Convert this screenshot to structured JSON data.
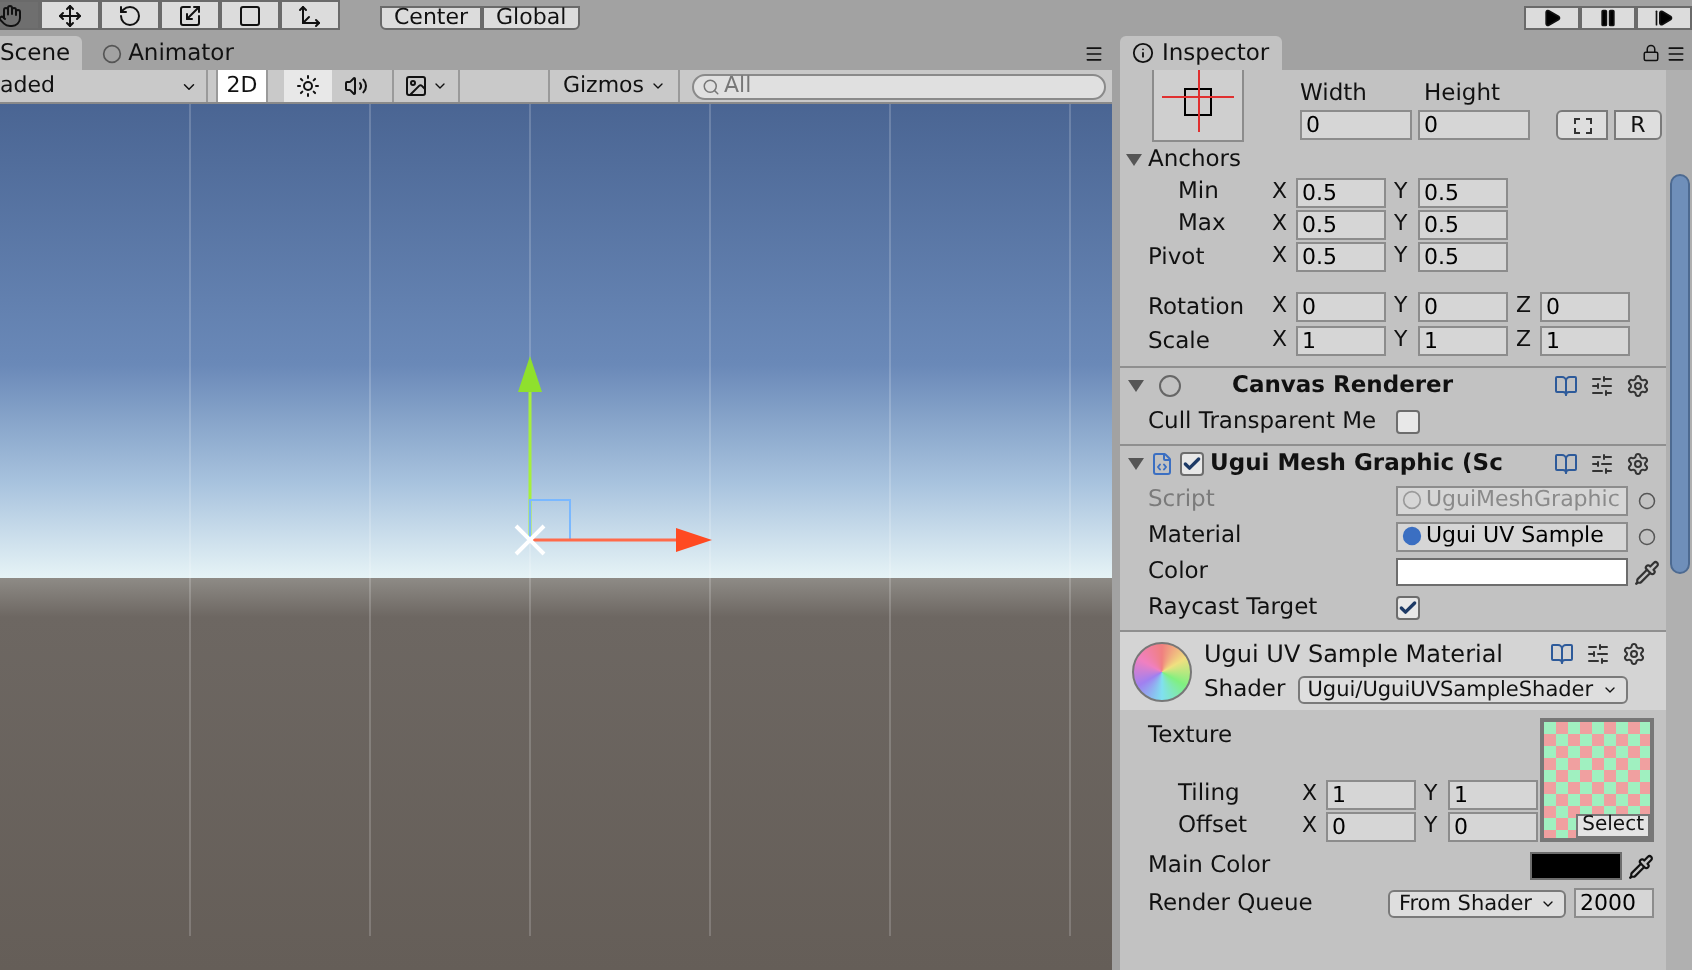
{
  "toolbar": {
    "pivot_mode": "Center",
    "pivot_rotation": "Global"
  },
  "tabs": [
    {
      "label": "Scene",
      "selected": true
    },
    {
      "label": "Animator",
      "selected": false
    }
  ],
  "scene_toolbar": {
    "draw_mode": "aded",
    "mode_2d": {
      "label": "2D",
      "on": true
    },
    "lighting": {
      "on": true
    },
    "gizmos": "Gizmos",
    "search": {
      "placeholder": "All"
    }
  },
  "inspector": {
    "tab": "Inspector",
    "rect_transform": {
      "size": [
        {
          "label": "Width",
          "value": "0"
        },
        {
          "label": "Height",
          "value": "0"
        }
      ],
      "raw_button": "R",
      "anchors": {
        "label": "Anchors",
        "expanded": true,
        "children": [
          {
            "label": "Min",
            "fields": [
              {
                "axis": "X",
                "value": "0.5"
              },
              {
                "axis": "Y",
                "value": "0.5"
              }
            ]
          },
          {
            "label": "Max",
            "fields": [
              {
                "axis": "X",
                "value": "0.5"
              },
              {
                "axis": "Y",
                "value": "0.5"
              }
            ]
          }
        ]
      },
      "vectors": [
        {
          "label": "Pivot",
          "fields": [
            {
              "axis": "X",
              "value": "0.5"
            },
            {
              "axis": "Y",
              "value": "0.5"
            }
          ]
        },
        {
          "label": "Rotation",
          "fields": [
            {
              "axis": "X",
              "value": "0"
            },
            {
              "axis": "Y",
              "value": "0"
            },
            {
              "axis": "Z",
              "value": "0"
            }
          ]
        },
        {
          "label": "Scale",
          "fields": [
            {
              "axis": "X",
              "value": "1"
            },
            {
              "axis": "Y",
              "value": "1"
            },
            {
              "axis": "Z",
              "value": "1"
            }
          ]
        }
      ]
    },
    "components": [
      {
        "title": "Canvas Renderer",
        "expanded": true,
        "properties": [
          {
            "kind": "checkbox",
            "label": "Cull Transparent Me",
            "checked": false
          }
        ]
      },
      {
        "title": "Ugui Mesh Graphic (Sc",
        "expanded": true,
        "enabled": true,
        "properties": [
          {
            "kind": "object",
            "label": "Script",
            "value": "UguiMeshGraphic",
            "disabled": true
          },
          {
            "kind": "object",
            "label": "Material",
            "value": "Ugui UV Sample",
            "disabled": false
          },
          {
            "kind": "color",
            "label": "Color",
            "color": "#ffffff"
          },
          {
            "kind": "checkbox",
            "label": "Raycast Target",
            "checked": true
          }
        ]
      }
    ],
    "material": {
      "title": "Ugui UV Sample Material",
      "shader_label": "Shader",
      "shader": "Ugui/UguiUVSampleShader",
      "texture": {
        "label": "Texture",
        "select": "Select",
        "rows": [
          {
            "label": "Tiling",
            "fields": [
              {
                "axis": "X",
                "value": "1"
              },
              {
                "axis": "Y",
                "value": "1"
              }
            ]
          },
          {
            "label": "Offset",
            "fields": [
              {
                "axis": "X",
                "value": "0"
              },
              {
                "axis": "Y",
                "value": "0"
              }
            ]
          }
        ]
      },
      "main_color": {
        "label": "Main Color",
        "color": "#000000"
      },
      "render_queue": {
        "label": "Render Queue",
        "mode": "From Shader",
        "value": "2000"
      }
    }
  }
}
